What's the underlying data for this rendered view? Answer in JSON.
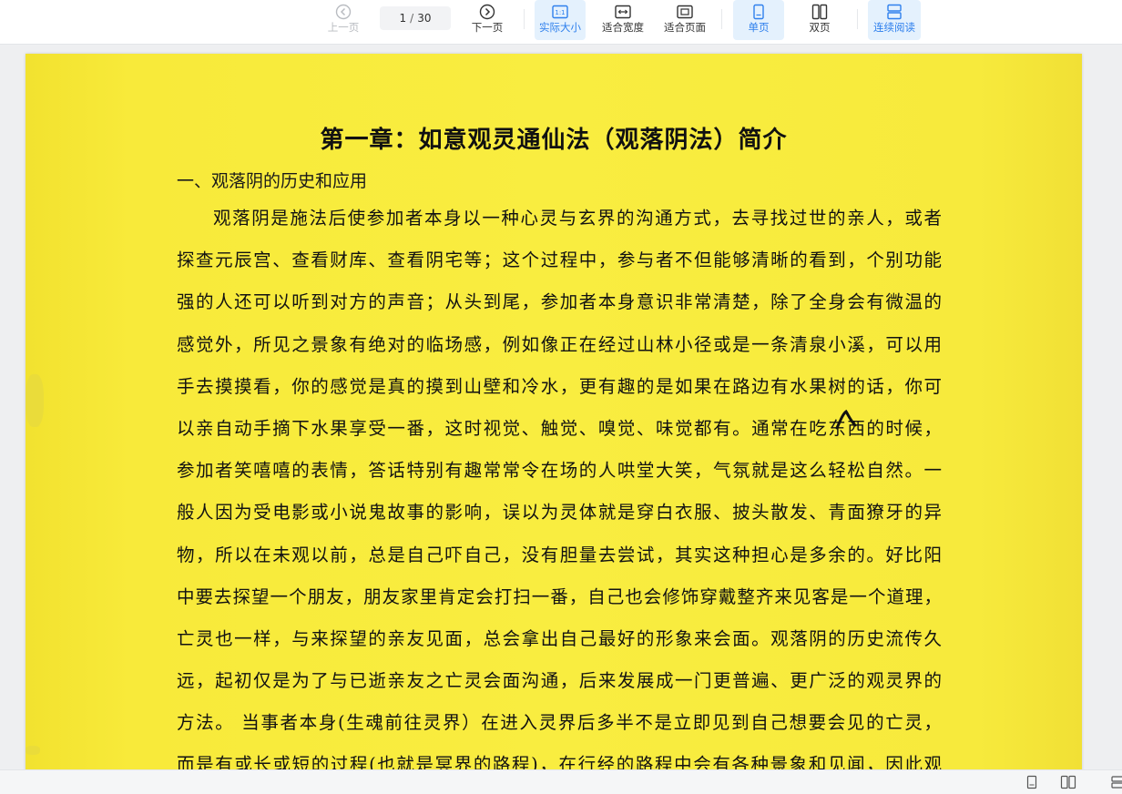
{
  "toolbar": {
    "prev_label": "上一页",
    "next_label": "下一页",
    "current_page": "1",
    "page_separator": "/",
    "total_pages": "30",
    "actual_size_label": "实际大小",
    "fit_width_label": "适合宽度",
    "fit_page_label": "适合页面",
    "single_page_label": "单页",
    "double_page_label": "双页",
    "continuous_label": "连续阅读",
    "accent_color": "#2f80ed",
    "active_states": {
      "actual_size": true,
      "single_page": true,
      "continuous": true,
      "prev_disabled": true
    }
  },
  "document": {
    "title": "第一章：如意观灵通仙法（观落阴法）简介",
    "section_heading": "一、观落阴的历史和应用",
    "lines": [
      "观落阴是施法后使参加者本身以一种心灵与玄界的沟通方式，去寻找过世的亲人，或者",
      "探查元辰宫、查看财库、查看阴宅等；这个过程中，参与者不但能够清晰的看到，个别功能",
      "强的人还可以听到对方的声音；从头到尾，参加者本身意识非常清楚，除了全身会有微温的",
      "感觉外，所见之景象有绝对的临场感，例如像正在经过山林小径或是一条清泉小溪，可以用",
      "手去摸摸看，你的感觉是真的摸到山壁和冷水，更有趣的是如果在路边有水果树的话，你可",
      "以亲自动手摘下水果享受一番，这时视觉、触觉、嗅觉、味觉都有。通常在吃东西的时候，",
      "参加者笑嘻嘻的表情，答话特别有趣常常令在场的人哄堂大笑，气氛就是这么轻松自然。一",
      "般人因为受电影或小说鬼故事的影响，误以为灵体就是穿白衣服、披头散发、青面獠牙的异",
      "物，所以在未观以前，总是自己吓自己，没有胆量去尝试，其实这种担心是多余的。好比阳",
      "中要去探望一个朋友，朋友家里肯定会打扫一番，自己也会修饰穿戴整齐来见客是一个道理，",
      "亡灵也一样，与来探望的亲友见面，总会拿出自己最好的形象来会面。观落阴的历史流传久",
      "远，起初仅是为了与已逝亲友之亡灵会面沟通，后来发展成一门更普遍、更广泛的观灵界的",
      "方法。 当事者本身(生魂前往灵界）在进入灵界后多半不是立即见到自己想要会见的亡灵，",
      "而是有或长或短的过程(也就是冥界的路程)，在行经的路程中会有各种景象和见闻，因此观"
    ],
    "page_color": "#f8ea3a"
  }
}
